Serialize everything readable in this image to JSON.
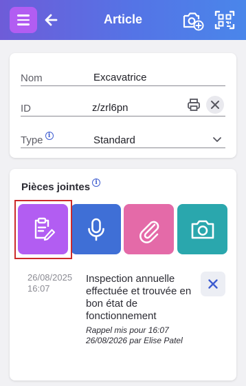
{
  "header": {
    "title": "Article",
    "colors": {
      "gradient_start": "#6e5cd8",
      "gradient_end": "#4a86ea",
      "menu_button": "#b25df2"
    },
    "icons": [
      "menu-icon",
      "back-arrow-icon",
      "camera-add-icon",
      "qr-scan-icon"
    ]
  },
  "details": {
    "name": {
      "label": "Nom",
      "value": "Excavatrice"
    },
    "id": {
      "label": "ID",
      "value": "z/zrl6pn"
    },
    "type": {
      "label": "Type",
      "value": "Standard"
    }
  },
  "attachments": {
    "title": "Pièces jointes",
    "tiles": [
      {
        "icon": "note-edit-icon",
        "color": "#b25df2"
      },
      {
        "icon": "microphone-icon",
        "color": "#3f6fd6"
      },
      {
        "icon": "paperclip-icon",
        "color": "#e46aa8"
      },
      {
        "icon": "camera-icon",
        "color": "#2aa7ad"
      }
    ],
    "items": [
      {
        "date": "26/08/2025",
        "time": "16:07",
        "text": "Inspection annuelle effectuée et trouvée en bon état de fonctionnement",
        "reminder": "Rappel mis pour 16:07 26/08/2026 par Elise Patel"
      }
    ]
  }
}
